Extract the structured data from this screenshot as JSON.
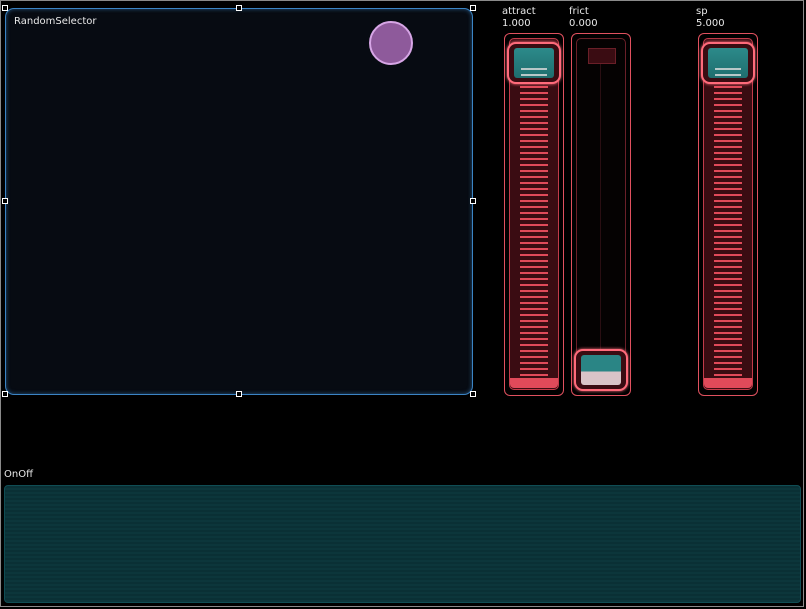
{
  "random_selector": {
    "title": "RandomSelector"
  },
  "sliders": [
    {
      "name": "attract",
      "value": "1.000",
      "level": 1.0
    },
    {
      "name": "frict",
      "value": "0.000",
      "level": 0.0
    },
    {
      "name": "sp",
      "value": "5.000",
      "level": 1.0
    }
  ],
  "onoff": {
    "title": "OnOff"
  },
  "colors": {
    "panel_border": "#3b84c4",
    "slider_accent": "#e0515f",
    "knob_face": "#2c8a8a",
    "dot_fill": "#8e5a9b",
    "onoff_fill": "#0a3035"
  }
}
